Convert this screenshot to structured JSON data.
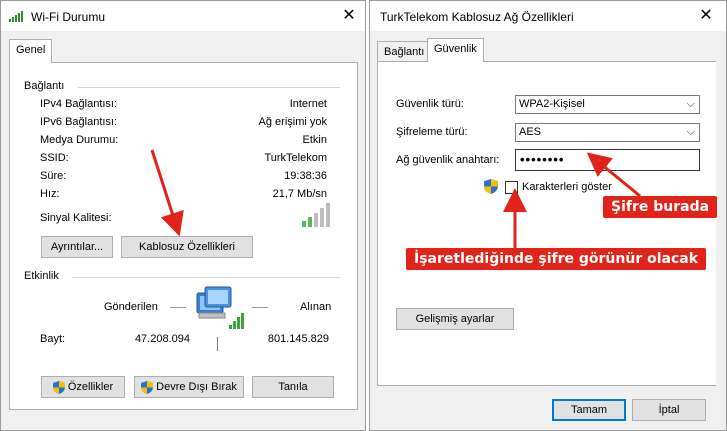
{
  "left_window": {
    "title": "Wi-Fi Durumu",
    "tab": "Genel",
    "connection_group": "Bağlantı",
    "rows": [
      {
        "label": "IPv4 Bağlantısı:",
        "value": "Internet"
      },
      {
        "label": "IPv6 Bağlantısı:",
        "value": "Ağ erişimi yok"
      },
      {
        "label": "Medya Durumu:",
        "value": "Etkin"
      },
      {
        "label": "SSID:",
        "value": "TurkTelekom"
      },
      {
        "label": "Süre:",
        "value": "19:38:36"
      },
      {
        "label": "Hız:",
        "value": "21,7 Mb/sn"
      }
    ],
    "signal_label": "Sinyal Kalitesi:",
    "signal_bars_level": "4/5",
    "details_button": "Ayrıntılar...",
    "wireless_props_button": "Kablosuz Özellikleri",
    "activity_group": "Etkinlik",
    "sent_label": "Gönderilen",
    "received_label": "Alınan",
    "bytes_label": "Bayt:",
    "sent_value": "47.208.094",
    "received_value": "801.145.829",
    "properties_button": "Özellikler",
    "disable_button": "Devre Dışı Bırak",
    "diagnose_button": "Tanıla"
  },
  "right_window": {
    "title": "TurkTelekom  Kablosuz Ağ Özellikleri",
    "tabs": [
      "Bağlantı",
      "Güvenlik"
    ],
    "active_tab": "Güvenlik",
    "security_type_label": "Güvenlik türü:",
    "security_type_value": "WPA2-Kişisel",
    "encryption_type_label": "Şifreleme türü:",
    "encryption_type_value": "AES",
    "key_label": "Ağ güvenlik anahtarı:",
    "key_value": "••••••••",
    "show_chars_label": "Karakterleri göster",
    "show_chars_checked": false,
    "advanced_button": "Gelişmiş ayarlar",
    "ok_button": "Tamam",
    "cancel_button": "İptal"
  },
  "annotations": {
    "password_here": "Şifre burada",
    "checkbox_hint": "İşaretlediğinde şifre görünür olacak",
    "accent_color": "#e2231a"
  },
  "icons": [
    "wifi-signal-icon",
    "close-icon",
    "shield-icon",
    "network-computer-icon",
    "chevron-down-icon"
  ]
}
